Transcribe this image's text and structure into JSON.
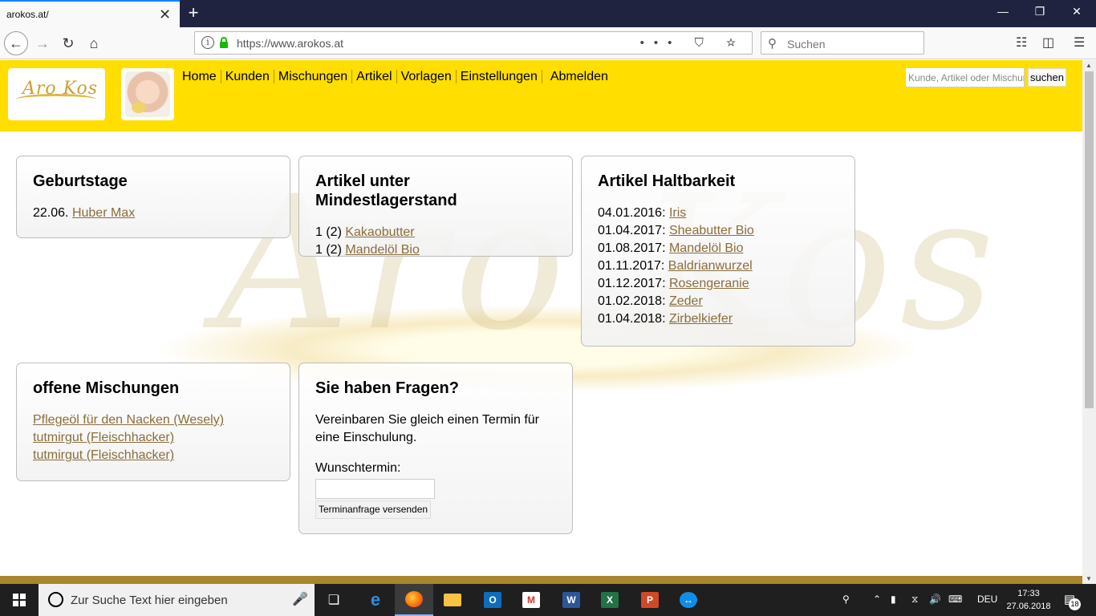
{
  "browser": {
    "tab_title": "arokos.at/",
    "tab_close": "✕",
    "new_tab": "+",
    "url": "https://www.arokos.at",
    "search_placeholder": "Suchen",
    "url_actions": "••• ⛉ ☆"
  },
  "header": {
    "logo_text": "Aro Kos",
    "menu": [
      "Home",
      "Kunden",
      "Mischungen",
      "Artikel",
      "Vorlagen",
      "Einstellungen",
      "Abmelden"
    ],
    "search_placeholder": "Kunde, Artikel oder Mischung",
    "search_button": "suchen",
    "colors": {
      "header_bg": "#ffde00",
      "link": "#8a6d3b",
      "footer_bar": "#a8862d"
    }
  },
  "watermark_text": "Aro Kos",
  "cards": {
    "birthdays": {
      "title": "Geburtstage",
      "rows": [
        {
          "prefix": "22.06. ",
          "link": "Huber Max"
        }
      ]
    },
    "low_stock": {
      "title": "Artikel unter Mindestlagerstand",
      "rows": [
        {
          "prefix": "1 (2) ",
          "link": "Kakaobutter"
        },
        {
          "prefix": "1 (2) ",
          "link": "Mandelöl Bio"
        }
      ]
    },
    "shelf_life": {
      "title": "Artikel Haltbarkeit",
      "rows": [
        {
          "prefix": "04.01.2016: ",
          "link": "Iris"
        },
        {
          "prefix": "01.04.2017: ",
          "link": "Sheabutter Bio"
        },
        {
          "prefix": "01.08.2017: ",
          "link": "Mandelöl Bio"
        },
        {
          "prefix": "01.11.2017: ",
          "link": "Baldrianwurzel"
        },
        {
          "prefix": "01.12.2017: ",
          "link": "Rosengeranie"
        },
        {
          "prefix": "01.02.2018: ",
          "link": "Zeder"
        },
        {
          "prefix": "01.04.2018: ",
          "link": "Zirbelkiefer"
        }
      ]
    },
    "open_mixes": {
      "title": "offene Mischungen",
      "rows": [
        {
          "link": "Pflegeöl für den Nacken (Wesely)"
        },
        {
          "link": "tutmirgut (Fleischhacker)"
        },
        {
          "link": "tutmirgut (Fleischhacker)"
        }
      ]
    },
    "questions": {
      "title": "Sie haben Fragen?",
      "text": "Vereinbaren Sie gleich einen Termin für eine Einschulung.",
      "label": "Wunschtermin:",
      "button": "Terminanfrage versenden"
    }
  },
  "taskbar": {
    "search_text": "Zur Suche Text hier eingeben",
    "language": "DEU",
    "time": "17:33",
    "date": "27.06.2018",
    "notification_count": "18"
  }
}
